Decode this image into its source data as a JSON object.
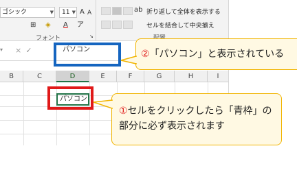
{
  "ribbon": {
    "font_name": "ゴシック",
    "font_size": "11",
    "font_group_label": "フォント",
    "wrap_text_label": "折り返して全体を表示する",
    "merge_center_label": "セルを結合して中央揃え",
    "alignment_group_label": "配置"
  },
  "formula_bar": {
    "value": "パソコン"
  },
  "grid": {
    "columns": [
      "B",
      "C",
      "D",
      "E",
      "F",
      "G",
      "H",
      "I"
    ],
    "selected_column": "D",
    "selected_cell_value": "パソコン"
  },
  "callouts": {
    "top": {
      "number": "②",
      "text": "「パソコン」と表示されている"
    },
    "bottom": {
      "number": "①",
      "text": "セルをクリックしたら「青枠」の部分に必ず表示されます"
    }
  },
  "colors": {
    "blue_frame": "#1565c0",
    "red_frame": "#e01919",
    "bubble_fill": "#fff9e3",
    "bubble_border": "#f1b400",
    "excel_green": "#217346"
  }
}
